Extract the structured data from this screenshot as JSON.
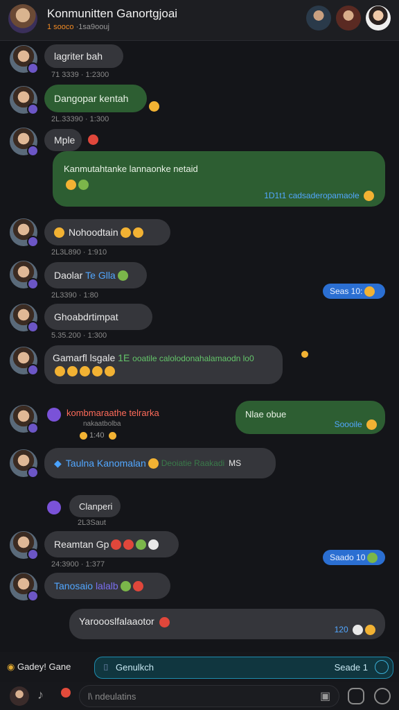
{
  "header": {
    "title": "Konmunitten Ganortgjoai",
    "subtitle_accent": "1 sooco",
    "subtitle_rest": "·1sa9oouj"
  },
  "messages": [
    {
      "text": "lagriter bah",
      "time": "71 3339 · 1:2300"
    },
    {
      "text": "Dangopar kentah",
      "time": "2L.33390 · 1:300"
    },
    {
      "text": "Mple"
    },
    {
      "text": "Kanmutahtanke lannaonke netaid",
      "inner_link": "1D1t1 cadsaderopamaole"
    },
    {
      "text": "Nohoodtain",
      "time": "2L3L890 · 1:910"
    },
    {
      "text": "Daolar",
      "link": "Te Glla",
      "time": "2L3390 · 1:80",
      "right_pill": "Seas 10:"
    },
    {
      "text": "Ghoabdrtimpat",
      "time": "5.35.200 · 1:300"
    },
    {
      "text": "Gamarfl lsgale",
      "green": "1E",
      "rest": "ooatile calolodonahalamaodn lo0"
    },
    {
      "text": "kombmaraathe telrarka",
      "sub": "nakaatbolba",
      "time_small": "1:40"
    },
    {
      "text": "Nlae obue",
      "footer": "Soooile"
    },
    {
      "text": "Taulna Kanomalan",
      "rest": "Deoiatie Raakadi",
      "tail": "MS"
    },
    {
      "text": "Clanperi",
      "time": "2L3Saut"
    },
    {
      "text": "Reamtan Gp",
      "time": "24:3900 · 1:377",
      "right_pill": "Saado 10"
    },
    {
      "text": "Tanosaio",
      "link": "lalalb"
    },
    {
      "text": "Yaroooslfalaaotor",
      "footer": "120"
    }
  ],
  "composer": {
    "left_label": "Gadey! Gane",
    "search_placeholder": "Genulkch",
    "search_right": "Seade 1",
    "input_placeholder": "l\\ ndeulatins"
  }
}
